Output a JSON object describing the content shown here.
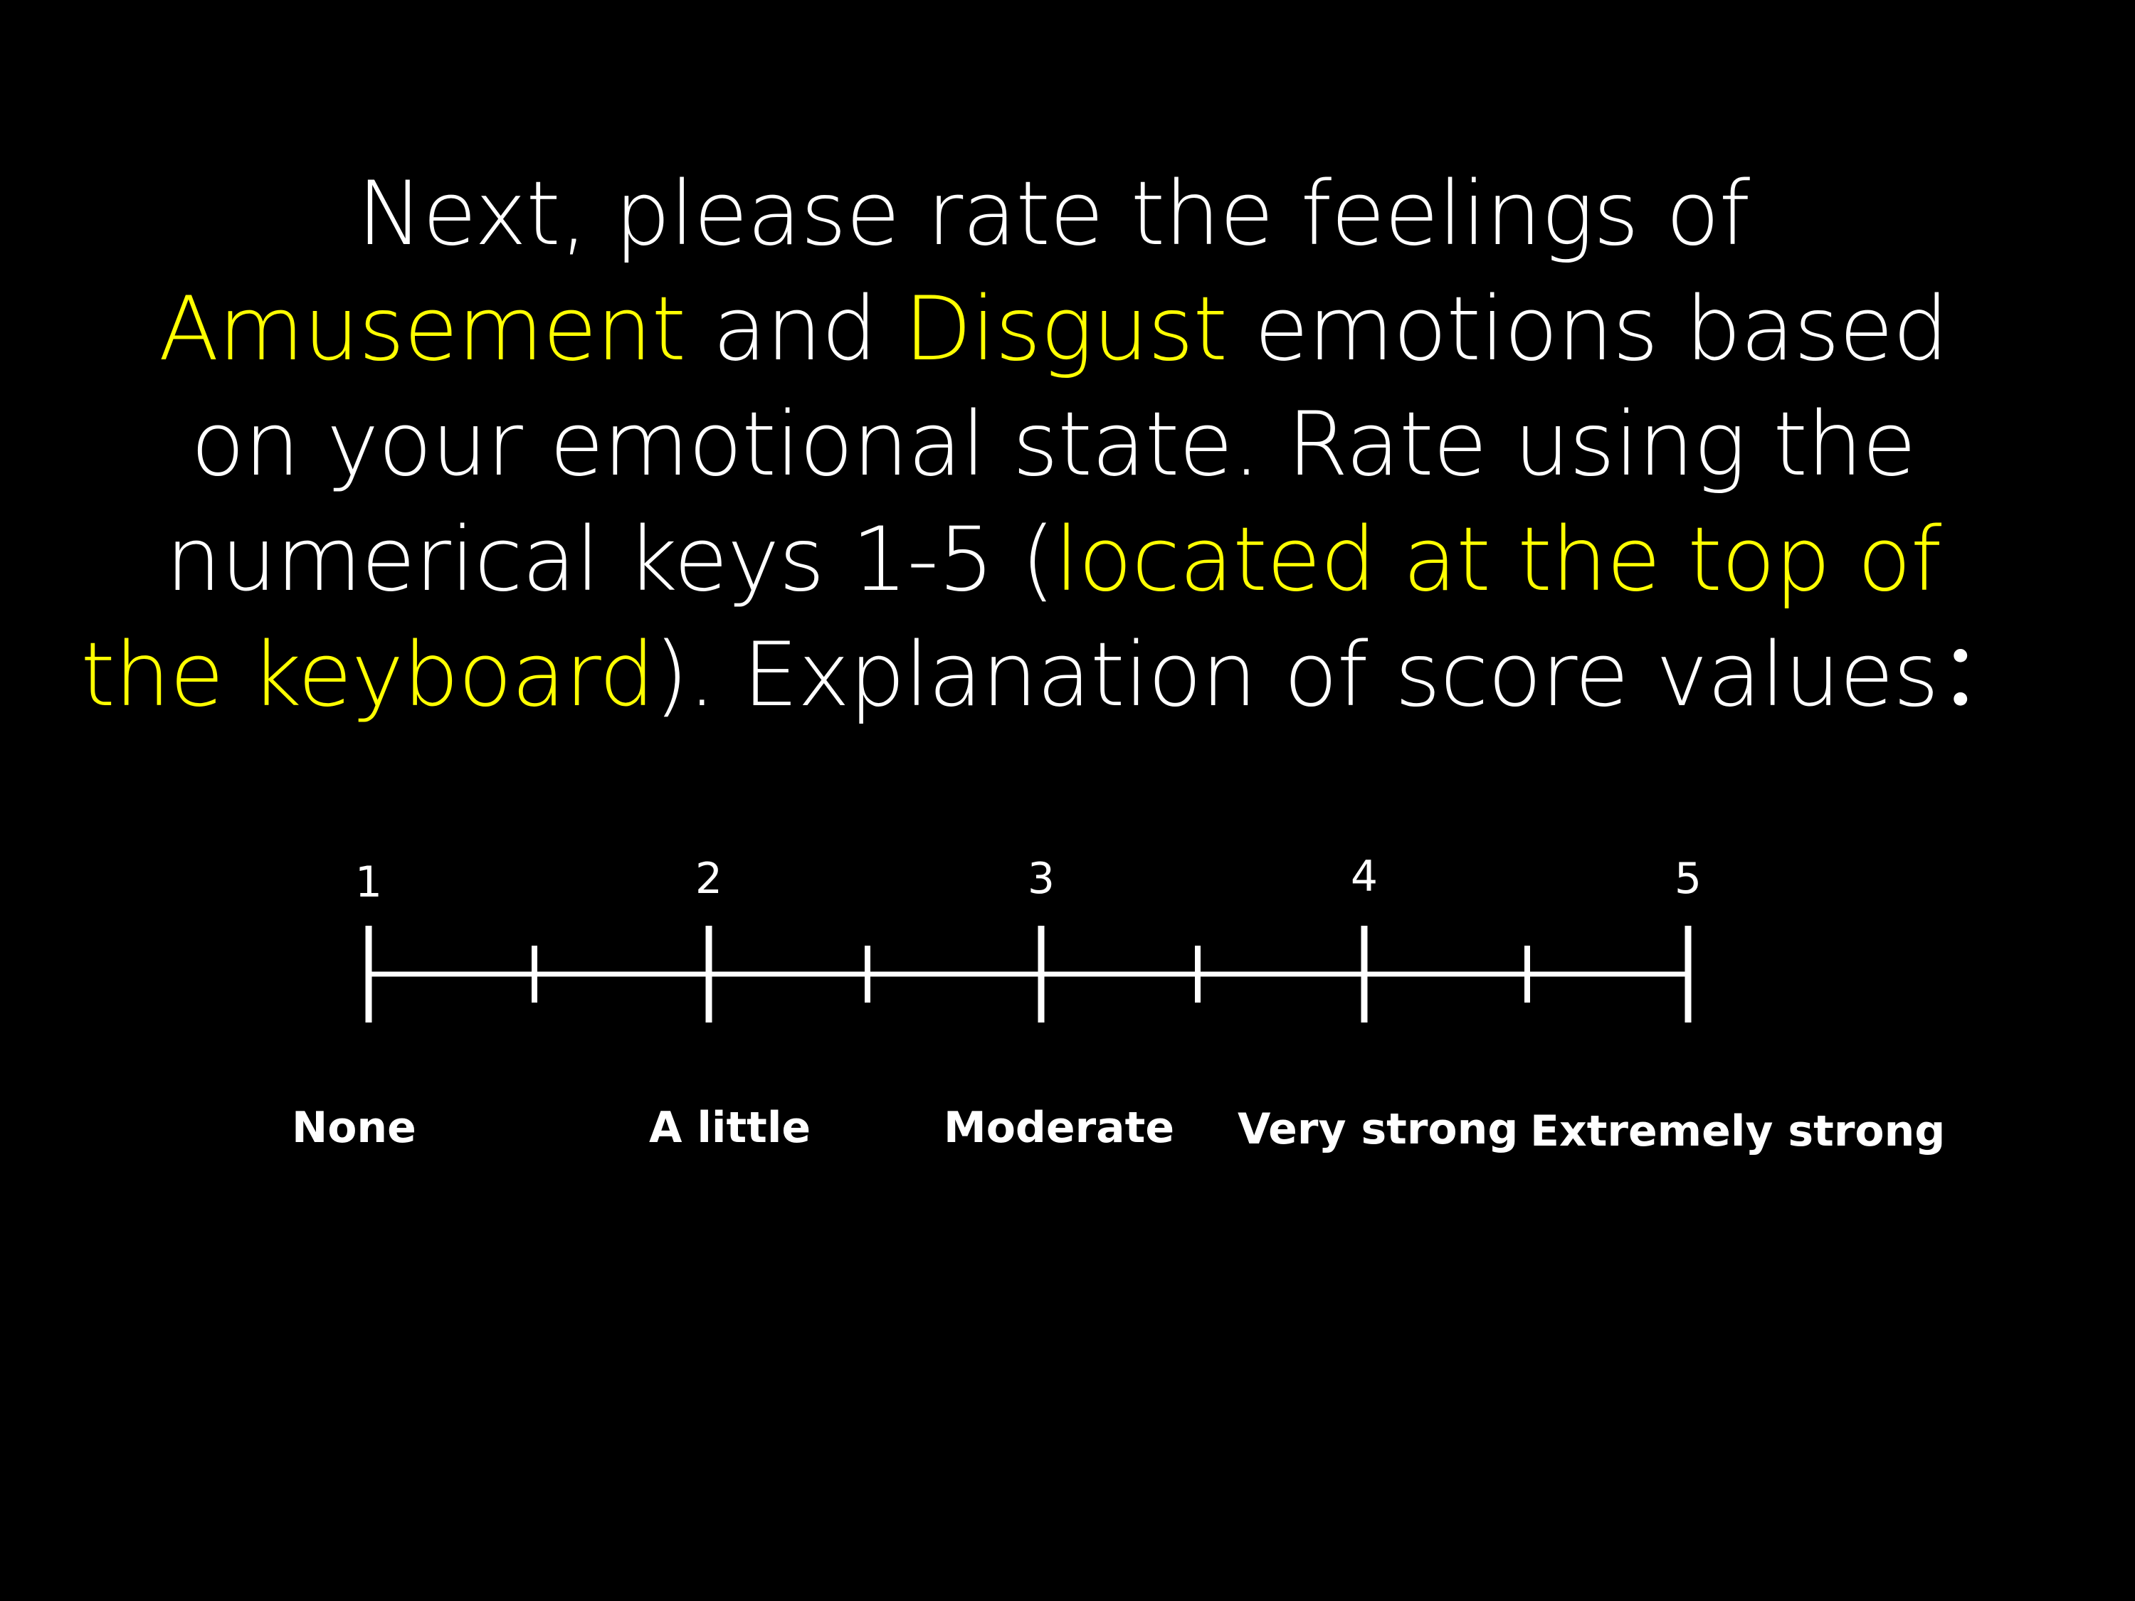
{
  "theme": {
    "background": "#000000",
    "text_color": "#ffffff",
    "highlight_color": "#ffff00"
  },
  "instructions": {
    "lines": [
      [
        {
          "text": "Next, please rate the feelings of",
          "highlight": false
        }
      ],
      [
        {
          "text": "Amusement",
          "highlight": true
        },
        {
          "text": " and ",
          "highlight": false
        },
        {
          "text": "Disgust",
          "highlight": true
        },
        {
          "text": " emotions based",
          "highlight": false
        }
      ],
      [
        {
          "text": "on your emotional state. Rate using the",
          "highlight": false
        }
      ],
      [
        {
          "text": "numerical keys 1-5 (",
          "highlight": false
        },
        {
          "text": "located at the top of",
          "highlight": true
        }
      ],
      [
        {
          "text": "the keyboard",
          "highlight": true
        },
        {
          "text": "). Explanation of score values：",
          "highlight": false
        }
      ]
    ]
  },
  "rating_scale": {
    "points": [
      {
        "number": "1",
        "label": "None"
      },
      {
        "number": "2",
        "label": "A little"
      },
      {
        "number": "3",
        "label": "Moderate"
      },
      {
        "number": "4",
        "label": "Very strong"
      },
      {
        "number": "5",
        "label": "Extremely strong"
      }
    ]
  }
}
